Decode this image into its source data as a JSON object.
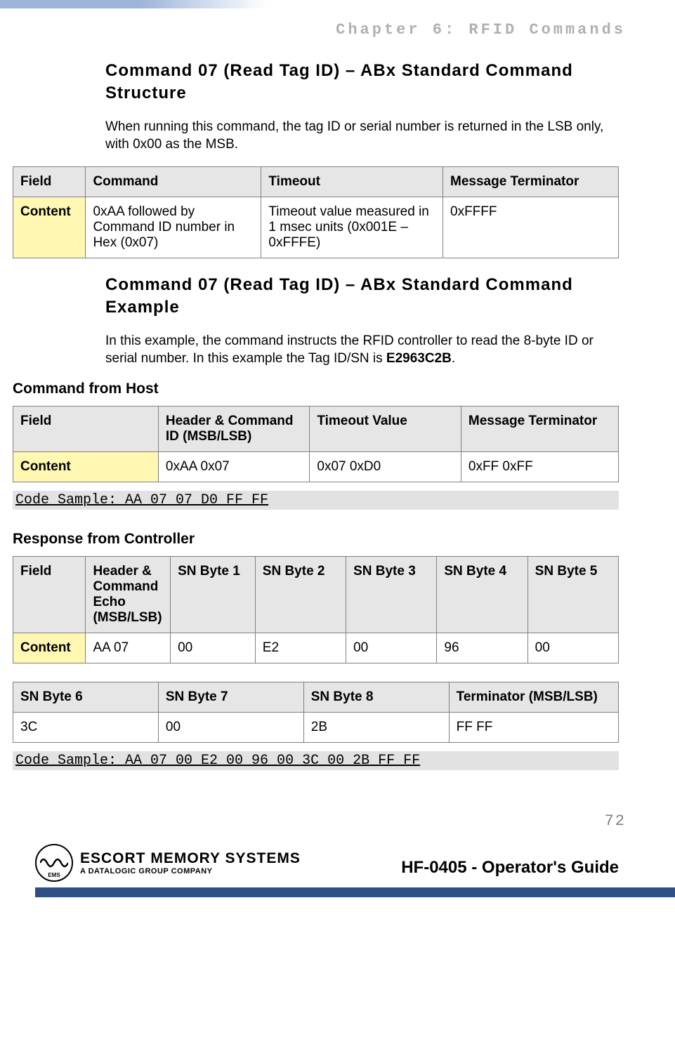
{
  "chapter_header": "Chapter 6: RFID Commands",
  "section1": {
    "title": "Command 07 (Read Tag ID) – ABx Standard Command Structure",
    "paragraph": "When running this command, the tag ID or serial number is returned in the LSB only, with 0x00 as the MSB."
  },
  "table1": {
    "headers": [
      "Field",
      "Command",
      "Timeout",
      "Message Terminator"
    ],
    "row_label": "Content",
    "cells": [
      "0xAA followed by Command ID number in Hex (0x07)",
      "Timeout value measured in 1 msec units (0x001E – 0xFFFE)",
      "0xFFFF"
    ]
  },
  "section2": {
    "title": "Command 07 (Read Tag ID) – ABx Standard Command Example",
    "paragraph": "In this example, the command instructs the RFID controller to read the 8-byte ID or serial number. In this example the Tag ID/SN is ",
    "bold": "E2963C2B",
    "suffix": "."
  },
  "cmd_host": {
    "heading": "Command from Host",
    "headers": [
      "Field",
      "Header & Command ID (MSB/LSB)",
      "Timeout Value",
      "Message Terminator"
    ],
    "row_label": "Content",
    "cells": [
      "0xAA 0x07",
      "0x07 0xD0",
      "0xFF 0xFF"
    ],
    "code": "Code Sample: AA 07 07 D0 FF FF"
  },
  "resp_ctrl": {
    "heading": "Response from Controller",
    "t1_headers": [
      "Field",
      "Header & Command Echo (MSB/LSB)",
      "SN Byte 1",
      "SN Byte 2",
      "SN Byte 3",
      "SN Byte 4",
      "SN Byte 5"
    ],
    "t1_row_label": "Content",
    "t1_cells": [
      "AA 07",
      "00",
      "E2",
      "00",
      "96",
      "00"
    ],
    "t2_headers": [
      "SN Byte 6",
      "SN Byte 7",
      "SN Byte 8",
      "Terminator (MSB/LSB)"
    ],
    "t2_cells": [
      "3C",
      "00",
      "2B",
      "FF FF"
    ],
    "code": "Code Sample: AA 07 00 E2 00 96 00 3C 00 2B FF FF"
  },
  "page_number": "72",
  "footer": {
    "logo_ems": "EMS",
    "logo_line1": "ESCORT MEMORY SYSTEMS",
    "logo_line2": "A DATALOGIC GROUP COMPANY",
    "doc_title": "HF-0405 - Operator's Guide"
  }
}
